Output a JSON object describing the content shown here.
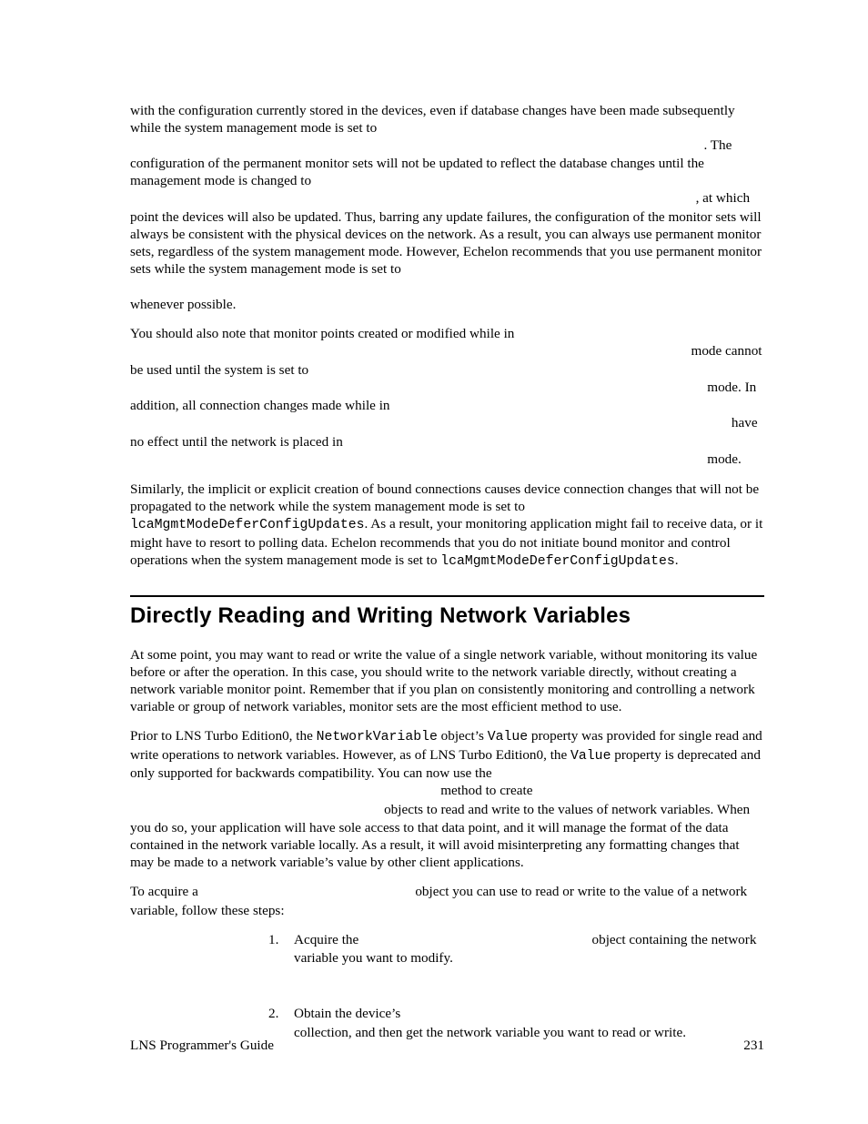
{
  "para1_a": "with the configuration currently stored in the devices, even if database changes have been made subsequently while the system management mode is set to ",
  "para1_b": ". The configuration of the permanent monitor sets will not be updated to reflect the database changes until the management mode is changed to ",
  "para1_c": ", at which point the devices will also be updated. Thus, barring any update failures, the configuration of the monitor sets will always be consistent with the physical devices on the network. As a result, you can always use permanent monitor sets, regardless of the system management mode. However, Echelon recommends that you use permanent monitor sets while the system management mode is set to ",
  "para1_d": " whenever possible.",
  "gap_wide_defer": "                                                                       ",
  "gap_mode_changedto": "                                                                      ",
  "gap_long_whenever": "                                                                                                       ",
  "para2_a": "You should also note that monitor points created or modified while in ",
  "para2_b": " mode cannot be used until the system is set to ",
  "para2_c": " mode. In addition, all connection changes made while in ",
  "para2_d": " have no effect until the network is placed in ",
  "para2_e": " mode.",
  "gap_p2_1": "                                                                     ",
  "gap_p2_2": "                                                                       ",
  "gap_p2_3": "                                                                          ",
  "gap_p2_4": "                                                                       ",
  "para3_a": "Similarly, the implicit or explicit creation of bound connections causes device connection changes that will not be propagated to the network while the system management mode is set to ",
  "code3_a": "lcaMgmtModeDeferConfigUpdates",
  "para3_b": ". As a result, your monitoring application might fail to receive data, or it might have to resort to polling data. Echelon recommends that you do not initiate bound monitor and control operations when the system management mode is set to ",
  "code3_b": "lcaMgmtModeDeferConfigUpdates",
  "para3_c": ".",
  "heading": "Directly Reading and Writing Network Variables",
  "para4": "At some point, you may want to read or write the value of a single network variable, without monitoring its value before or after the operation. In this case, you should write to the network variable directly, without creating a network variable monitor point. Remember that if you plan on consistently monitoring and controlling a network variable or group of network variables, monitor sets are the most efficient method to use.",
  "para5_a": "Prior to LNS Turbo Edition0, the ",
  "code5_a": "NetworkVariable",
  "para5_b": " object’s ",
  "code5_b": "Value",
  "para5_c": " property was provided for single read and write operations to network variables. However, as of LNS Turbo Edition0, the ",
  "code5_c": "Value",
  "para5_d": " property is deprecated and only supported for backwards compatibility. You can now use the ",
  "para5_e": " method to create ",
  "para5_f": " objects to read and write to the values of network variables. When you do so, your application will have sole access to that data point, and it will manage the format of the data contained in the network variable locally. As a result, it will avoid misinterpreting any formatting changes that may be made to a network variable’s value by other client applications.",
  "gap_method": "                                      ",
  "gap_methodobj": "                               ",
  "para6_a": "To acquire a ",
  "para6_b": " object you can use to read or write to the value of a network variable, follow these steps:",
  "gap_acquire": "                          ",
  "step1_a": "Acquire the ",
  "step1_b": " object containing the network variable you want to modify.",
  "gap_step1": "                            ",
  "step2_a": "Obtain the device’s ",
  "step2_b": " collection, and then get the network variable you want to read or write.",
  "gap_step2": "                                           ",
  "footer_left": "LNS Programmer's Guide",
  "footer_right": "231"
}
